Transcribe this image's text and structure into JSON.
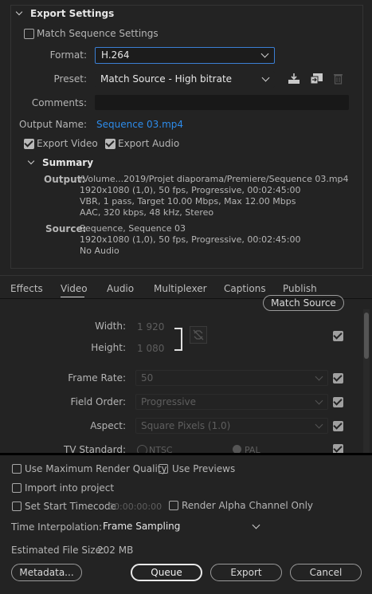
{
  "export_settings": {
    "header": "Export Settings",
    "match_sequence_label": "Match Sequence Settings",
    "format_label": "Format:",
    "format_value": "H.264",
    "preset_label": "Preset:",
    "preset_value": "Match Source - High bitrate",
    "comments_label": "Comments:",
    "comments_value": "",
    "output_name_label": "Output Name:",
    "output_name_value": "Sequence 03.mp4",
    "export_video_label": "Export Video",
    "export_audio_label": "Export Audio"
  },
  "summary": {
    "header": "Summary",
    "output_label": "Output:",
    "output_lines": [
      "/Volume...2019/Projet diaporama/Premiere/Sequence 03.mp4",
      "1920x1080 (1,0), 50 fps, Progressive, 00:02:45:00",
      "VBR, 1 pass, Target 10.00 Mbps, Max 12.00 Mbps",
      "AAC, 320 kbps, 48 kHz, Stereo"
    ],
    "source_label": "Source:",
    "source_lines": [
      "Sequence, Sequence 03",
      "1920x1080 (1,0), 50 fps, Progressive, 00:02:45:00",
      "No Audio"
    ]
  },
  "tabs": [
    "Effects",
    "Video",
    "Audio",
    "Multiplexer",
    "Captions",
    "Publish"
  ],
  "active_tab": "Video",
  "video": {
    "match_source_button": "Match Source",
    "width_label": "Width:",
    "width_value": "1 920",
    "height_label": "Height:",
    "height_value": "1 080",
    "frame_rate_label": "Frame Rate:",
    "frame_rate_value": "50",
    "field_order_label": "Field Order:",
    "field_order_value": "Progressive",
    "aspect_label": "Aspect:",
    "aspect_value": "Square Pixels (1.0)",
    "tv_standard_label": "TV Standard:",
    "ntsc_label": "NTSC",
    "pal_label": "PAL"
  },
  "bottom": {
    "max_render_label": "Use Maximum Render Quality",
    "use_previews_label": "Use Previews",
    "import_label": "Import into project",
    "set_start_timecode_label": "Set Start Timecode",
    "timecode_value": "00:00:00:00",
    "render_alpha_label": "Render Alpha Channel Only",
    "time_interp_label": "Time Interpolation:",
    "time_interp_value": "Frame Sampling",
    "file_size_label": "Estimated File Size:",
    "file_size_value": "202 MB",
    "metadata_button": "Metadata...",
    "queue_button": "Queue",
    "export_button": "Export",
    "cancel_button": "Cancel"
  },
  "colors": {
    "background": "#232323",
    "link": "#2d8ceb",
    "separator": "#000000"
  }
}
